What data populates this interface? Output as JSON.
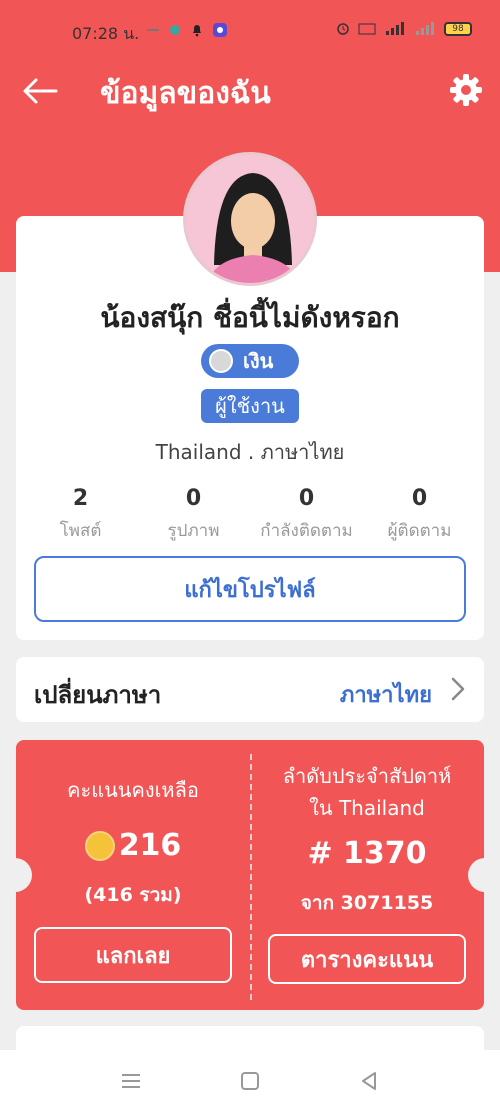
{
  "status": {
    "time": "07:28 น.",
    "battery": "98"
  },
  "header": {
    "title": "ข้อมูลของฉัน"
  },
  "profile": {
    "name": "น้องสนุ๊ก ชื่อนี้ไม่ดังหรอก",
    "badge_silver": "เงิน",
    "badge_user": "ผู้ใช้งาน",
    "location": "Thailand . ภาษาไทย",
    "stats": [
      {
        "value": "2",
        "label": "โพสต์"
      },
      {
        "value": "0",
        "label": "รูปภาพ"
      },
      {
        "value": "0",
        "label": "กำลังติดตาม"
      },
      {
        "value": "0",
        "label": "ผู้ติดตาม"
      }
    ],
    "edit_label": "แก้ไขโปรไฟล์"
  },
  "language": {
    "label": "เปลี่ยนภาษา",
    "value": "ภาษาไทย"
  },
  "points": {
    "remaining_title": "คะแนนคงเหลือ",
    "remaining_value": "216",
    "total": "(416 รวม)",
    "redeem_label": "แลกเลย",
    "rank_title_line1": "ลำดับประจำสัปดาห์",
    "rank_title_line2": "ใน Thailand",
    "rank_value": "# 1370",
    "rank_from": "จาก 3071155",
    "board_label": "ตารางคะแนน"
  },
  "colors": {
    "brand": "#f25555",
    "accent": "#4a7bd8"
  },
  "icons": {
    "back": "arrow-left",
    "settings": "gear",
    "chevron": "chevron-right",
    "medal": "silver-medal",
    "coin": "coin"
  }
}
